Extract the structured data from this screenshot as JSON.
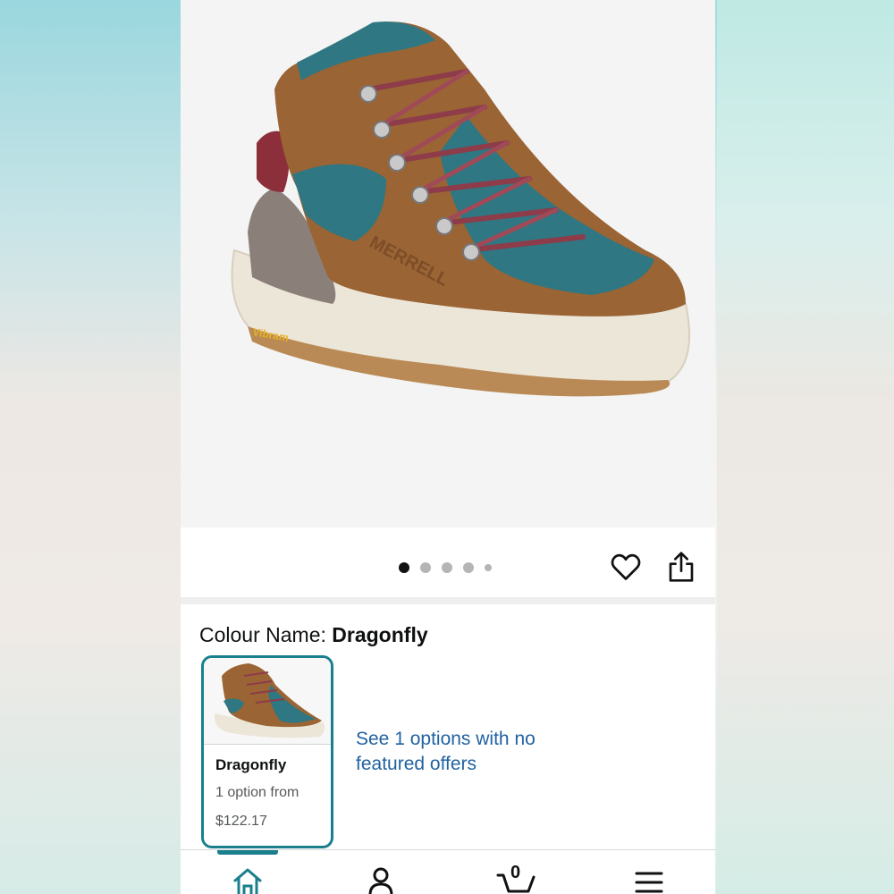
{
  "product": {
    "image_alt": "Merrell hiking boot - brown suede with teal mesh",
    "boot_brand_text": "MERRELL",
    "sole_brand_text": "Vibram"
  },
  "gallery": {
    "dots_total": 5,
    "active_index": 0
  },
  "actions": {
    "favorite_icon": "heart-icon",
    "share_icon": "share-icon"
  },
  "colour": {
    "label": "Colour Name: ",
    "value": "Dragonfly"
  },
  "swatches": [
    {
      "name": "Dragonfly",
      "options_text": "1 option from",
      "price": "$122.17"
    }
  ],
  "see_options_link": "See 1 options with no featured offers",
  "nav": {
    "items": [
      "home-icon",
      "account-icon",
      "cart-icon",
      "menu-icon"
    ],
    "cart_count": "0",
    "accent_color": "#1a7f8c"
  },
  "colors": {
    "accent": "#1a7f8c",
    "link": "#2162a1"
  }
}
